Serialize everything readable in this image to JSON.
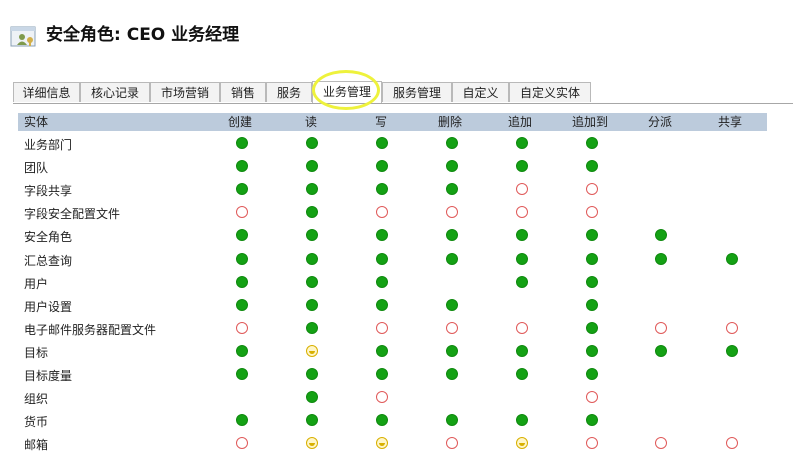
{
  "page": {
    "title": "安全角色: CEO 业务经理"
  },
  "tabs": [
    {
      "label": "详细信息",
      "active": false
    },
    {
      "label": "核心记录",
      "active": false
    },
    {
      "label": "市场营销",
      "active": false
    },
    {
      "label": "销售",
      "active": false
    },
    {
      "label": "服务",
      "active": false
    },
    {
      "label": "业务管理",
      "active": true
    },
    {
      "label": "服务管理",
      "active": false
    },
    {
      "label": "自定义",
      "active": false
    },
    {
      "label": "自定义实体",
      "active": false
    }
  ],
  "grid": {
    "columns": [
      "实体",
      "创建",
      "读",
      "写",
      "删除",
      "追加",
      "追加到",
      "分派",
      "共享"
    ],
    "rows": [
      {
        "entity": "业务部门",
        "cells": [
          "full",
          "full",
          "full",
          "full",
          "full",
          "full",
          "",
          ""
        ]
      },
      {
        "entity": "团队",
        "cells": [
          "full",
          "full",
          "full",
          "full",
          "full",
          "full",
          "",
          ""
        ]
      },
      {
        "entity": "字段共享",
        "cells": [
          "full",
          "full",
          "full",
          "full",
          "none",
          "none",
          "",
          ""
        ]
      },
      {
        "entity": "字段安全配置文件",
        "cells": [
          "none",
          "full",
          "none",
          "none",
          "none",
          "none",
          "",
          ""
        ]
      },
      {
        "entity": "安全角色",
        "cells": [
          "full",
          "full",
          "full",
          "full",
          "full",
          "full",
          "full",
          ""
        ]
      },
      {
        "entity": "汇总查询",
        "cells": [
          "full",
          "full",
          "full",
          "full",
          "full",
          "full",
          "full",
          "full"
        ]
      },
      {
        "entity": "用户",
        "cells": [
          "full",
          "full",
          "full",
          "",
          "full",
          "full",
          "",
          ""
        ]
      },
      {
        "entity": "用户设置",
        "cells": [
          "full",
          "full",
          "full",
          "full",
          "",
          "full",
          "",
          ""
        ]
      },
      {
        "entity": "电子邮件服务器配置文件",
        "cells": [
          "none",
          "full",
          "none",
          "none",
          "none",
          "full",
          "none",
          "none"
        ]
      },
      {
        "entity": "目标",
        "cells": [
          "full",
          "partial",
          "full",
          "full",
          "full",
          "full",
          "full",
          "full"
        ]
      },
      {
        "entity": "目标度量",
        "cells": [
          "full",
          "full",
          "full",
          "full",
          "full",
          "full",
          "",
          ""
        ]
      },
      {
        "entity": "组织",
        "cells": [
          "",
          "full",
          "none",
          "",
          "",
          "none",
          "",
          ""
        ]
      },
      {
        "entity": "货币",
        "cells": [
          "full",
          "full",
          "full",
          "full",
          "full",
          "full",
          "",
          ""
        ]
      },
      {
        "entity": "邮箱",
        "cells": [
          "none",
          "partial",
          "partial",
          "none",
          "partial",
          "none",
          "none",
          "none"
        ]
      }
    ]
  },
  "colors": {
    "full": "#14a114",
    "none": "#e05a5a",
    "partial": "#d8b000",
    "header_bg": "#bccbdc",
    "highlight": "#eef23c"
  }
}
